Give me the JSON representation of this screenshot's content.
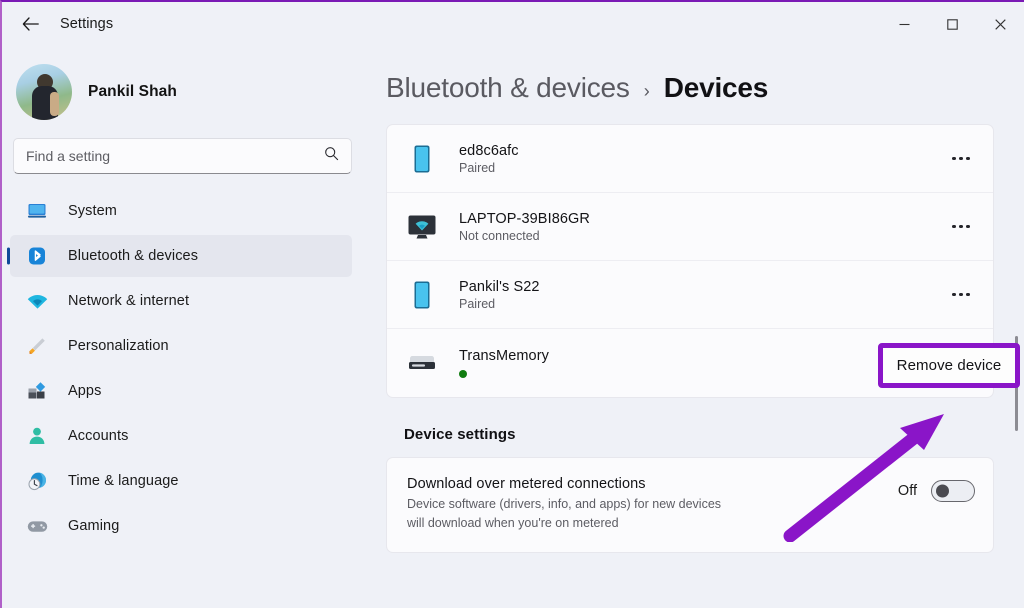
{
  "window": {
    "title": "Settings",
    "back_icon": "back-arrow-icon",
    "controls": {
      "minimize": "minimize-icon",
      "maximize": "maximize-icon",
      "close": "close-icon"
    }
  },
  "sidebar": {
    "profile": {
      "name": "Pankil Shah",
      "avatar": "user-avatar"
    },
    "search": {
      "placeholder": "Find a setting",
      "value": "",
      "icon": "search-icon"
    },
    "items": [
      {
        "label": "System",
        "icon": "system-icon",
        "selected": false
      },
      {
        "label": "Bluetooth & devices",
        "icon": "bluetooth-icon",
        "selected": true
      },
      {
        "label": "Network & internet",
        "icon": "wifi-icon",
        "selected": false
      },
      {
        "label": "Personalization",
        "icon": "paintbrush-icon",
        "selected": false
      },
      {
        "label": "Apps",
        "icon": "apps-icon",
        "selected": false
      },
      {
        "label": "Accounts",
        "icon": "person-icon",
        "selected": false
      },
      {
        "label": "Time & language",
        "icon": "clock-globe-icon",
        "selected": false
      },
      {
        "label": "Gaming",
        "icon": "gamepad-icon",
        "selected": false
      }
    ]
  },
  "main": {
    "breadcrumb": {
      "parent": "Bluetooth & devices",
      "separator": "›",
      "current": "Devices"
    },
    "devices": [
      {
        "name": "ed8c6afc",
        "status": "Paired",
        "icon": "phone-icon",
        "more": "more-options-icon"
      },
      {
        "name": "LAPTOP-39BI86GR",
        "status": "Not connected",
        "icon": "monitor-wifi-icon",
        "more": "more-options-icon"
      },
      {
        "name": "Pankil's S22",
        "status": "Paired",
        "icon": "phone-icon",
        "more": "more-options-icon"
      },
      {
        "name": "TransMemory",
        "status": "",
        "icon": "drive-icon",
        "more": "more-options-icon",
        "status_dot": "#107c10"
      }
    ],
    "device_settings": {
      "heading": "Device settings",
      "metered": {
        "title": "Download over metered connections",
        "description": "Device software (drivers, info, and apps) for new devices will download when you're on metered",
        "toggle_state": "Off"
      }
    }
  },
  "annotations": {
    "callout_label": "Remove device",
    "highlight_color": "#8a15c8",
    "arrow_color": "#8a15c8"
  }
}
